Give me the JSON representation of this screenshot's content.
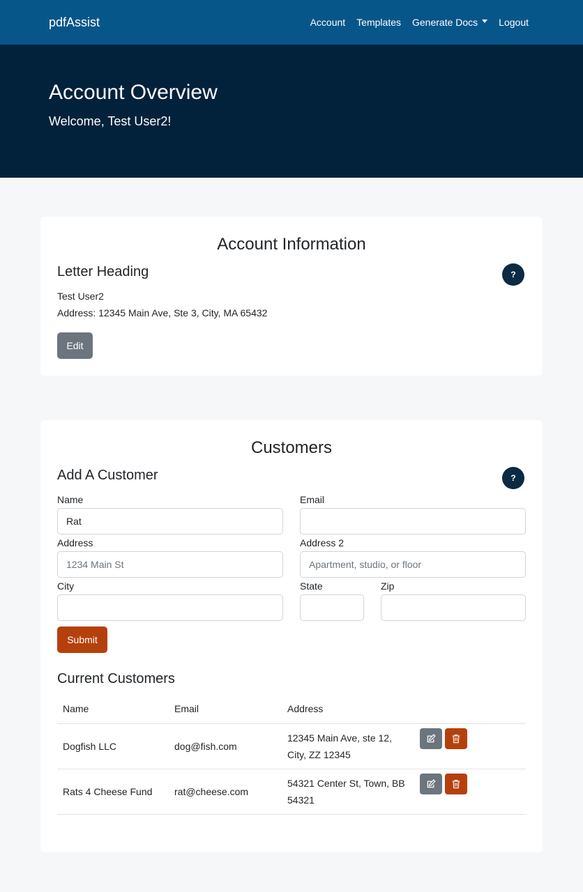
{
  "navbar": {
    "brand": "pdfAssist",
    "links": [
      "Account",
      "Templates",
      "Generate Docs",
      "Logout"
    ]
  },
  "hero": {
    "title": "Account Overview",
    "welcome": "Welcome, Test User2!"
  },
  "account_card": {
    "title": "Account Information",
    "section_title": "Letter Heading",
    "help_label": "?",
    "name": "Test User2",
    "address": "Address: 12345 Main Ave, Ste 3, City, MA 65432",
    "edit_label": "Edit"
  },
  "customers_card": {
    "title": "Customers",
    "section_title": "Add A Customer",
    "help_label": "?",
    "form": {
      "name_label": "Name",
      "name_value": "Rat",
      "email_label": "Email",
      "email_value": "",
      "address_label": "Address",
      "address_placeholder": "1234 Main St",
      "address2_label": "Address 2",
      "address2_placeholder": "Apartment, studio, or floor",
      "city_label": "City",
      "state_label": "State",
      "zip_label": "Zip",
      "submit_label": "Submit"
    },
    "list_title": "Current Customers",
    "columns": [
      "Name",
      "Email",
      "Address"
    ],
    "rows": [
      {
        "name": "Dogfish LLC",
        "email": "dog@fish.com",
        "address_line1": "12345 Main Ave, ste 12,",
        "address_line2": "City, ZZ 12345"
      },
      {
        "name": "Rats 4 Cheese Fund",
        "email": "rat@cheese.com",
        "address_line1": "54321 Center St, Town, BB",
        "address_line2": "54321"
      }
    ]
  },
  "colors": {
    "navbar": "#07568a",
    "hero": "#02223b",
    "accent": "#b5400c",
    "secondary": "#6c757d"
  }
}
